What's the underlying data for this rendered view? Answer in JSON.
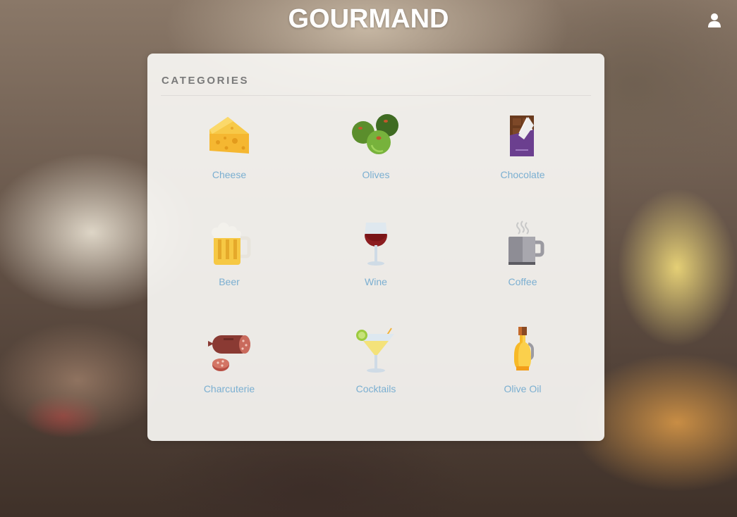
{
  "header": {
    "brand": "GOURMAND",
    "user_icon": "user-icon"
  },
  "panel": {
    "title": "CATEGORIES"
  },
  "categories": [
    {
      "label": "Cheese",
      "icon": "cheese-icon"
    },
    {
      "label": "Olives",
      "icon": "olives-icon"
    },
    {
      "label": "Chocolate",
      "icon": "chocolate-icon"
    },
    {
      "label": "Beer",
      "icon": "beer-icon"
    },
    {
      "label": "Wine",
      "icon": "wine-icon"
    },
    {
      "label": "Coffee",
      "icon": "coffee-icon"
    },
    {
      "label": "Charcuterie",
      "icon": "charcuterie-icon"
    },
    {
      "label": "Cocktails",
      "icon": "cocktail-icon"
    },
    {
      "label": "Olive Oil",
      "icon": "olive-oil-icon"
    }
  ],
  "colors": {
    "link": "#7bafd1",
    "title": "#7a7a7a",
    "panel_bg": "#f8f6f3"
  }
}
